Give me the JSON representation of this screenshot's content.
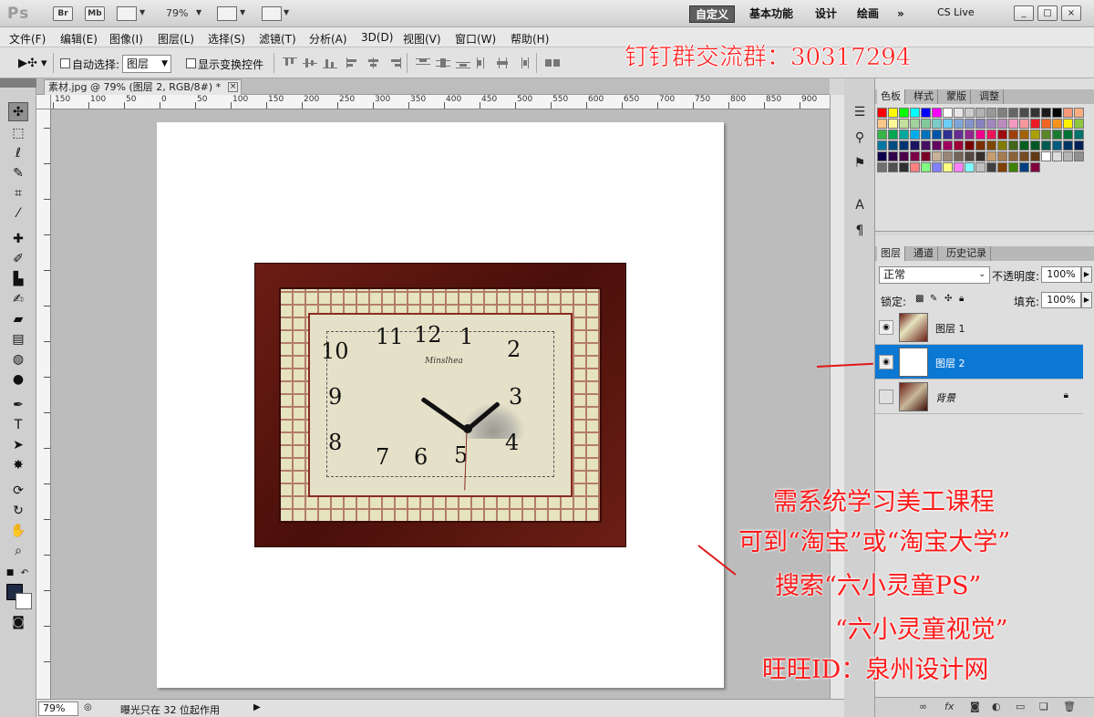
{
  "app": {
    "logo": "Ps",
    "zoom": "79%",
    "badges": [
      "Br",
      "Mb"
    ]
  },
  "workspaces": [
    "自定义",
    "基本功能",
    "设计",
    "绘画",
    "»"
  ],
  "cslive": "CS Live",
  "window_buttons": [
    "_",
    "□",
    "×"
  ],
  "menu": [
    "文件(F)",
    "编辑(E)",
    "图像(I)",
    "图层(L)",
    "选择(S)",
    "滤镜(T)",
    "分析(A)",
    "3D(D)",
    "视图(V)",
    "窗口(W)",
    "帮助(H)"
  ],
  "options": {
    "auto_select_label": "自动选择:",
    "auto_select_value": "图层",
    "transform_label": "显示变换控件"
  },
  "document": {
    "tab_title": "素材.jpg @ 79% (图层 2, RGB/8#) *"
  },
  "ruler_labels": [
    "150",
    "100",
    "50",
    "0",
    "50",
    "100",
    "150",
    "200",
    "250",
    "300",
    "350",
    "400",
    "450",
    "500",
    "550",
    "600",
    "650",
    "700",
    "750",
    "800",
    "850",
    "900"
  ],
  "clock": {
    "brand": "Minslhea",
    "numerals": [
      "11",
      "12",
      "1",
      "2",
      "10",
      "3",
      "9",
      "8",
      "4",
      "7",
      "6",
      "5"
    ]
  },
  "swatch_panel": {
    "tabs": [
      "色板",
      "样式",
      "蒙版",
      "调整"
    ]
  },
  "swatch_colors": [
    "#ff0000",
    "#ffff00",
    "#00ff00",
    "#00ffff",
    "#0000ff",
    "#ff00ff",
    "#ffffff",
    "#e6e6e6",
    "#cccccc",
    "#b3b3b3",
    "#999999",
    "#808080",
    "#666666",
    "#4d4d4d",
    "#333333",
    "#1a1a1a",
    "#000000",
    "#f7977a",
    "#f9ad81",
    "#fdc68a",
    "#fff79a",
    "#c4df9b",
    "#a3d39c",
    "#82ca9d",
    "#7bcdc8",
    "#6ecff6",
    "#7ea7d8",
    "#8493ca",
    "#8882be",
    "#a187be",
    "#bc8dbf",
    "#f49ac2",
    "#f6989d",
    "#ed1c24",
    "#f26522",
    "#f7941d",
    "#fff200",
    "#8dc73f",
    "#39b54a",
    "#00a651",
    "#00a99d",
    "#00aeef",
    "#0072bc",
    "#0054a6",
    "#2e3192",
    "#662d91",
    "#92278f",
    "#ec008c",
    "#ed145b",
    "#9e0b0f",
    "#a0410d",
    "#a36209",
    "#aba000",
    "#598527",
    "#1a7b30",
    "#007236",
    "#00746b",
    "#0076a3",
    "#004b80",
    "#003471",
    "#1b1464",
    "#440e62",
    "#630460",
    "#9e005d",
    "#9e0039",
    "#790000",
    "#7b2e00",
    "#7d4900",
    "#827b00",
    "#406618",
    "#005e20",
    "#005826",
    "#005952",
    "#005b7f",
    "#003663",
    "#002157",
    "#0d004c",
    "#32004b",
    "#4b0049",
    "#7b0046",
    "#7a0026",
    "#c7b299",
    "#998675",
    "#736357",
    "#534741",
    "#37302a",
    "#c69c6d",
    "#a67c52",
    "#8c6239",
    "#754c24",
    "#603913",
    "#ffffff",
    "#dcdcdc",
    "#b5b5b5",
    "#909090",
    "#707070",
    "#505050",
    "#303030",
    "#ff8080",
    "#80ff80",
    "#8080ff",
    "#ffff80",
    "#ff80ff",
    "#80ffff",
    "#c0c0c0",
    "#404040",
    "#804000",
    "#408000",
    "#004080",
    "#800040"
  ],
  "layers_panel": {
    "tabs": [
      "图层",
      "通道",
      "历史记录"
    ],
    "blend_mode": "正常",
    "opacity_label": "不透明度:",
    "opacity": "100%",
    "lock_label": "锁定:",
    "fill_label": "填充:",
    "fill": "100%",
    "layers": [
      {
        "name": "图层 1",
        "visible": true,
        "selected": false
      },
      {
        "name": "图层 2",
        "visible": true,
        "selected": true
      },
      {
        "name": "背景",
        "visible": false,
        "selected": false,
        "locked": true
      }
    ],
    "footer_icons": [
      "链接",
      "fx",
      "蒙版",
      "调整",
      "组",
      "新建",
      "删除"
    ]
  },
  "status": {
    "zoom": "79%",
    "message": "曝光只在 32 位起作用"
  },
  "overlay": {
    "qq_group": "钉钉群交流群：30317294",
    "lines": [
      "需系统学习美工课程",
      "可到“淘宝”或“淘宝大学”",
      "搜索“六小灵童PS”",
      "“六小灵童视觉”",
      "旺旺ID：泉州设计网"
    ]
  },
  "colors": {
    "accent": "#0b78d4",
    "overlay_text": "#ff1a1a",
    "foreground": "#1f2a44",
    "background": "#ffffff"
  }
}
